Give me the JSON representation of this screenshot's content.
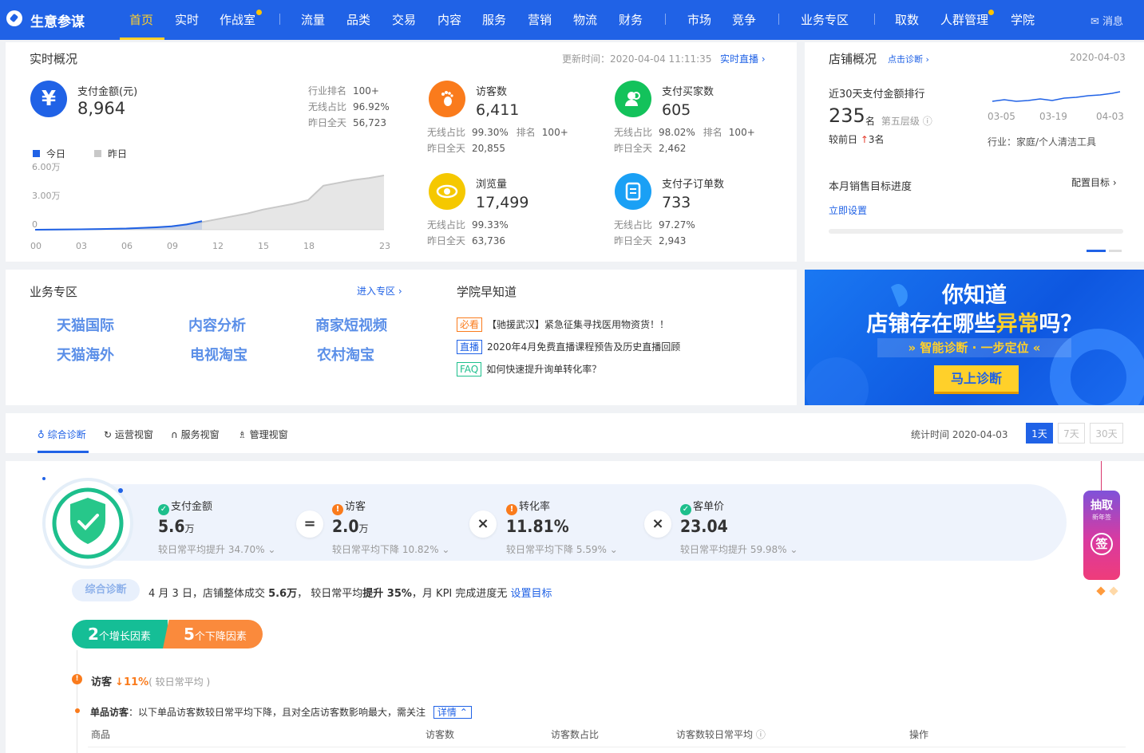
{
  "brand": "生意参谋",
  "nav": {
    "items": [
      "首页",
      "实时",
      "作战室",
      "流量",
      "品类",
      "交易",
      "内容",
      "服务",
      "营销",
      "物流",
      "财务",
      "市场",
      "竞争",
      "业务专区",
      "取数",
      "人群管理",
      "学院"
    ],
    "message": "消息"
  },
  "realtime": {
    "title": "实时概况",
    "update_label": "更新时间：2020-04-04 11:11:35",
    "live_link": "实时直播",
    "pay": {
      "label": "支付金额(元)",
      "value": "8,964",
      "rank_label": "行业排名",
      "rank": "100+",
      "wireless_label": "无线占比",
      "wireless": "96.92%",
      "yesterday_label": "昨日全天",
      "yesterday": "56,723"
    },
    "legend": {
      "today": "今日",
      "yesterday": "昨日"
    },
    "stats": [
      {
        "label": "访客数",
        "value": "6,411",
        "r1k": "无线占比",
        "r1v": "99.30%",
        "r1k2": "排名",
        "r1v2": "100+",
        "r2k": "昨日全天",
        "r2v": "20,855"
      },
      {
        "label": "支付买家数",
        "value": "605",
        "r1k": "无线占比",
        "r1v": "98.02%",
        "r1k2": "排名",
        "r1v2": "100+",
        "r2k": "昨日全天",
        "r2v": "2,462"
      },
      {
        "label": "浏览量",
        "value": "17,499",
        "r1k": "无线占比",
        "r1v": "99.33%",
        "r1k2": "",
        "r1v2": "",
        "r2k": "昨日全天",
        "r2v": "63,736"
      },
      {
        "label": "支付子订单数",
        "value": "733",
        "r1k": "无线占比",
        "r1v": "97.27%",
        "r1k2": "",
        "r1v2": "",
        "r2k": "昨日全天",
        "r2v": "2,943"
      }
    ]
  },
  "chart_data": {
    "type": "area",
    "x": [
      "00",
      "03",
      "06",
      "09",
      "12",
      "15",
      "18",
      "23"
    ],
    "yticks": [
      "6.00万",
      "3.00万",
      "0"
    ],
    "ylim": [
      0,
      60000
    ],
    "series": [
      {
        "name": "今日",
        "color": "#2062e6",
        "points": [
          [
            0,
            0
          ],
          [
            3,
            400
          ],
          [
            6,
            1200
          ],
          [
            8,
            2500
          ],
          [
            9,
            3500
          ],
          [
            10,
            5500
          ],
          [
            11,
            8964
          ]
        ]
      },
      {
        "name": "昨日",
        "color": "#c8c8c8",
        "points": [
          [
            0,
            0
          ],
          [
            3,
            400
          ],
          [
            6,
            1200
          ],
          [
            9,
            3500
          ],
          [
            11,
            8000
          ],
          [
            12,
            11000
          ],
          [
            13,
            14000
          ],
          [
            14,
            17000
          ],
          [
            15,
            21000
          ],
          [
            16,
            24000
          ],
          [
            17,
            27000
          ],
          [
            18,
            31000
          ],
          [
            19,
            46000
          ],
          [
            20,
            49000
          ],
          [
            21,
            52000
          ],
          [
            22,
            54000
          ],
          [
            23,
            56723
          ]
        ]
      }
    ]
  },
  "overview": {
    "title": "店铺概况",
    "diag_link": "点击诊断",
    "date": "2020-04-03",
    "rank_label": "近30天支付金额排行",
    "rank": "235",
    "rank_unit": "名",
    "tier": "第五层级",
    "compare_label": "较前日",
    "compare_value": "3名",
    "dates": [
      "03-05",
      "03-19",
      "04-03"
    ],
    "industry": "行业：家庭/个人清洁工具",
    "target_label": "本月销售目标进度",
    "config": "配置目标",
    "set_now": "立即设置"
  },
  "business": {
    "title": "业务专区",
    "enter": "进入专区",
    "items": [
      "天猫国际",
      "内容分析",
      "商家短视频",
      "天猫海外",
      "电视淘宝",
      "农村淘宝"
    ]
  },
  "academy": {
    "title": "学院早知道",
    "items": [
      {
        "tag": "必看",
        "text": "【驰援武汉】紧急征集寻找医用物资货！！",
        "color": "#fa7b1c"
      },
      {
        "tag": "直播",
        "text": "2020年4月免费直播课程预告及历史直播回顾",
        "color": "#2062e6"
      },
      {
        "tag": "FAQ",
        "text": "如何快速提升询单转化率？",
        "color": "#1dbf8c"
      }
    ]
  },
  "banner": {
    "line1": "你知道",
    "line2a": "店铺存在哪些",
    "line2b": "异常",
    "line2c": "吗？",
    "line3": "» 智能诊断 · 一步定位 «",
    "button": "马上诊断"
  },
  "diag": {
    "tabs": [
      "综合诊断",
      "运营视窗",
      "服务视窗",
      "管理视窗"
    ],
    "stat_label": "统计时间 2020-04-03",
    "ranges": [
      "1天",
      "7天",
      "30天"
    ],
    "metrics": [
      {
        "label": "支付金额",
        "value": "5.6",
        "unit": "万",
        "sub": "较日常平均提升 34.70%",
        "status": "ok"
      },
      {
        "label": "访客",
        "value": "2.0",
        "unit": "万",
        "sub": "较日常平均下降 10.82%",
        "status": "warn"
      },
      {
        "label": "转化率",
        "value": "11.81%",
        "unit": "",
        "sub": "较日常平均下降 5.59%",
        "status": "warn"
      },
      {
        "label": "客单价",
        "value": "23.04",
        "unit": "",
        "sub": "较日常平均提升 59.98%",
        "status": "ok"
      }
    ],
    "ops": [
      "=",
      "×",
      "×"
    ],
    "summary_tag": "综合诊断",
    "summary": {
      "t1": "4 月 3 日，店铺整体成交 ",
      "v1": "5.6万",
      "t2": "， 较日常平均",
      "v2": "提升 35%",
      "t3": "，月 KPI 完成进度无",
      "link": "设置目标"
    },
    "growth": {
      "n": "2",
      "label": "个增长因素"
    },
    "decline": {
      "n": "5",
      "label": "个下降因素"
    },
    "factor": {
      "name": "访客",
      "change": "↓11%",
      "note": "( 较日常平均 )"
    },
    "single": {
      "label": "单品访客",
      "text": "：以下单品访客数较日常平均下降，且对全店访客数影响最大，需关注",
      "detail": "详情"
    },
    "table_headers": [
      "商品",
      "访客数",
      "访客数占比",
      "访客数较日常平均",
      "操作"
    ],
    "sign": {
      "a": "抽取",
      "b": "新年签",
      "c": "签"
    }
  }
}
